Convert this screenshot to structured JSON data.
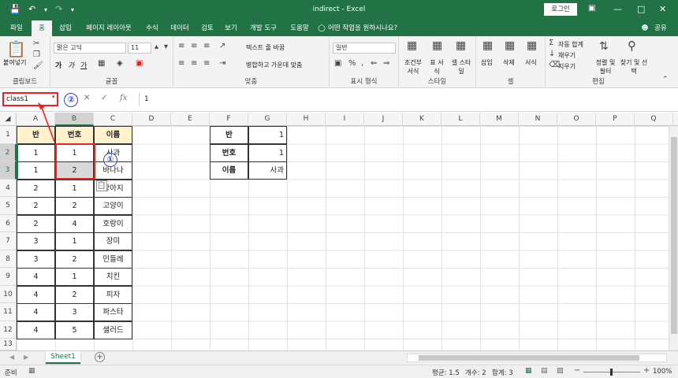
{
  "title_bar": {
    "title": "indirect  -  Excel",
    "login": "로그인",
    "save_icon": "save-icon",
    "undo_icon": "undo-icon",
    "redo_icon": "redo-icon"
  },
  "tabs": [
    {
      "label": "파일"
    },
    {
      "label": "홈"
    },
    {
      "label": "삽입"
    },
    {
      "label": "페이지 레이아웃"
    },
    {
      "label": "수식"
    },
    {
      "label": "데이터"
    },
    {
      "label": "검토"
    },
    {
      "label": "보기"
    },
    {
      "label": "개발 도구"
    },
    {
      "label": "도움말"
    }
  ],
  "tell_me": "어떤 작업을 원하시나요?",
  "share": "공유",
  "ribbon": {
    "clipboard": {
      "paste": "붙여넣기",
      "label": "클립보드"
    },
    "font": {
      "name": "맑은 고딕",
      "size": "11",
      "label": "글꼴",
      "bold": "가",
      "italic": "가",
      "underline": "가"
    },
    "alignment": {
      "wrap": "텍스트 줄 바꿈",
      "merge": "병합하고 가운데 맞춤",
      "label": "맞춤"
    },
    "number": {
      "format": "일반",
      "label": "표시 형식"
    },
    "styles": {
      "conditional": "조건부 서식",
      "table": "표 서식",
      "cell": "셀 스타일",
      "label": "스타일"
    },
    "cells": {
      "insert": "삽입",
      "delete": "삭제",
      "format": "서식",
      "label": "셀"
    },
    "editing": {
      "autosum": "자동 합계",
      "fill": "채우기",
      "clear": "지우기",
      "sort": "정렬 및 필터",
      "find": "찾기 및 선택",
      "label": "편집"
    }
  },
  "formula_bar": {
    "name_box": "class1",
    "fx": "fx",
    "value": "1"
  },
  "callouts": {
    "one": "①",
    "two": "②"
  },
  "columns": [
    "A",
    "B",
    "C",
    "D",
    "E",
    "F",
    "G",
    "H",
    "I",
    "J",
    "K",
    "L",
    "M",
    "N",
    "O",
    "P",
    "Q"
  ],
  "rows": [
    "1",
    "2",
    "3",
    "4",
    "5",
    "6",
    "7",
    "8",
    "9",
    "10",
    "11",
    "12",
    "13"
  ],
  "table": {
    "headers": [
      "반",
      "번호",
      "이름"
    ],
    "rows": [
      [
        "1",
        "1",
        "사과"
      ],
      [
        "1",
        "2",
        "바나나"
      ],
      [
        "2",
        "1",
        "강아지"
      ],
      [
        "2",
        "2",
        "고양이"
      ],
      [
        "2",
        "4",
        "호랑이"
      ],
      [
        "3",
        "1",
        "장미"
      ],
      [
        "3",
        "2",
        "민들레"
      ],
      [
        "4",
        "1",
        "치킨"
      ],
      [
        "4",
        "2",
        "피자"
      ],
      [
        "4",
        "3",
        "파스타"
      ],
      [
        "4",
        "5",
        "샐러드"
      ]
    ]
  },
  "lookup": [
    {
      "label": "반",
      "value": "1"
    },
    {
      "label": "번호",
      "value": "1"
    },
    {
      "label": "이름",
      "value": "사과"
    }
  ],
  "sheet_tab": "Sheet1",
  "status": {
    "ready": "준비",
    "average": "평균: 1.5",
    "count": "개수: 2",
    "sum": "합계: 3",
    "zoom": "100%"
  }
}
